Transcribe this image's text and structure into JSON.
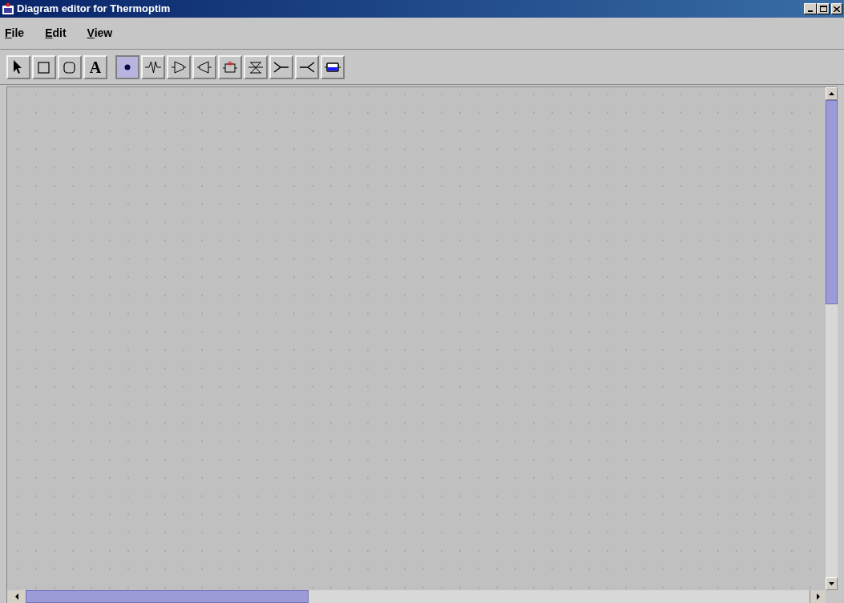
{
  "window": {
    "title": "Diagram editor for Thermoptim"
  },
  "menu": [
    "File",
    "Edit",
    "View"
  ],
  "drawing_tools": [
    {
      "kind": "pointer",
      "selected": false
    },
    {
      "kind": "rectangle",
      "selected": false
    },
    {
      "kind": "rounded",
      "selected": false
    },
    {
      "kind": "text",
      "label": "A",
      "selected": false
    }
  ],
  "component_tools": [
    {
      "kind": "point",
      "selected": true
    },
    {
      "kind": "resistor",
      "selected": false
    },
    {
      "kind": "compressor",
      "selected": false
    },
    {
      "kind": "turbine",
      "selected": false
    },
    {
      "kind": "combustion",
      "selected": false
    },
    {
      "kind": "valve",
      "selected": false
    },
    {
      "kind": "mixer",
      "selected": false
    },
    {
      "kind": "divider",
      "selected": false
    },
    {
      "kind": "exchanger",
      "selected": false
    }
  ]
}
